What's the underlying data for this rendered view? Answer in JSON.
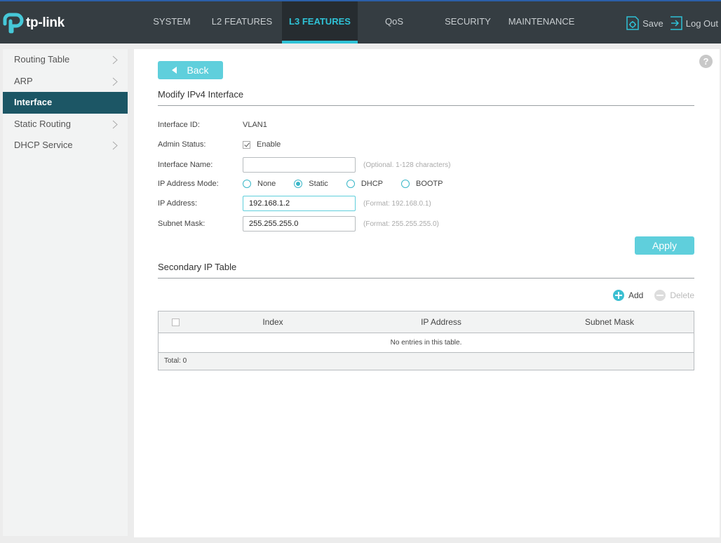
{
  "brand": {
    "logo_text": "tp-link"
  },
  "nav": {
    "items": [
      {
        "label": "SYSTEM",
        "active": false
      },
      {
        "label": "L2 FEATURES",
        "active": false
      },
      {
        "label": "L3 FEATURES",
        "active": true
      },
      {
        "label": "QoS",
        "active": false
      },
      {
        "label": "SECURITY",
        "active": false
      },
      {
        "label": "MAINTENANCE",
        "active": false
      }
    ],
    "save_label": "Save",
    "logout_label": "Log Out"
  },
  "sidebar": {
    "items": [
      {
        "label": "Routing Table",
        "active": false
      },
      {
        "label": "ARP",
        "active": false
      },
      {
        "label": "Interface",
        "active": true
      },
      {
        "label": "Static Routing",
        "active": false
      },
      {
        "label": "DHCP Service",
        "active": false
      }
    ]
  },
  "main": {
    "help_label": "?",
    "back_label": "Back",
    "section_title": "Modify IPv4 Interface",
    "interface_id": {
      "label": "Interface ID:",
      "value": "VLAN1"
    },
    "admin_status": {
      "label": "Admin Status:",
      "checkbox_label": "Enable",
      "checked": true
    },
    "interface_name": {
      "label": "Interface Name:",
      "value": "",
      "hint": "(Optional. 1-128 characters)"
    },
    "ip_mode": {
      "label": "IP Address Mode:",
      "options": [
        "None",
        "Static",
        "DHCP",
        "BOOTP"
      ],
      "selected": "Static"
    },
    "ip_address": {
      "label": "IP Address:",
      "value": "192.168.1.2",
      "hint": "(Format: 192.168.0.1)"
    },
    "subnet_mask": {
      "label": "Subnet Mask:",
      "value": "255.255.255.0",
      "hint": "(Format: 255.255.255.0)"
    },
    "apply_label": "Apply",
    "secondary_title": "Secondary IP Table",
    "add_label": "Add",
    "delete_label": "Delete",
    "table": {
      "columns": [
        "Index",
        "IP Address",
        "Subnet Mask"
      ],
      "empty_text": "No entries in this table.",
      "total_text": "Total: 0"
    }
  },
  "colors": {
    "accent": "#5fcfdc",
    "topbar": "#353d42",
    "sidebar_active": "#1c5665"
  }
}
